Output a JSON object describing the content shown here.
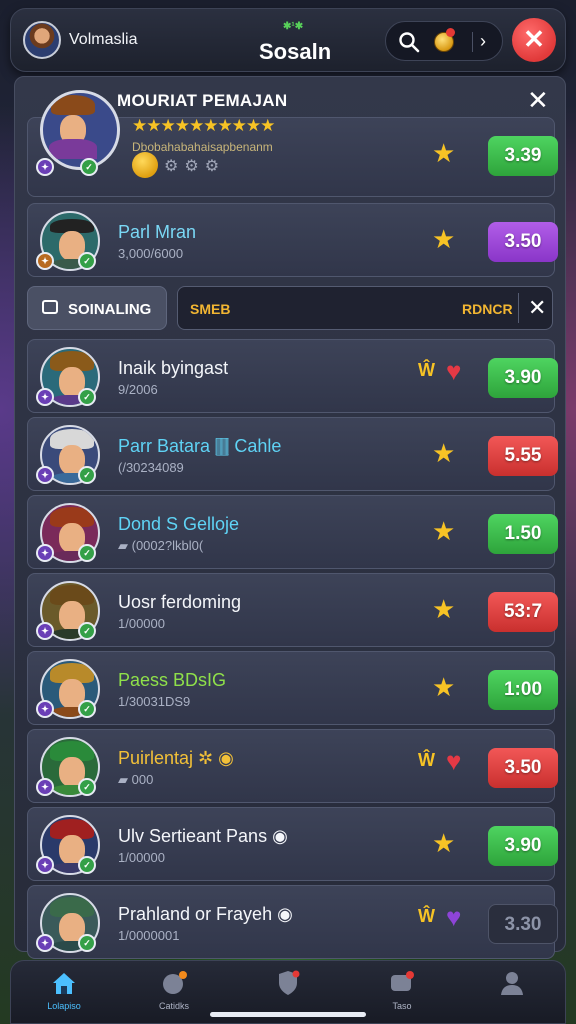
{
  "header": {
    "brand_name": "Volmaslia",
    "title": "Sosaln",
    "title_flair": "✱¹✱"
  },
  "panel": {
    "title": "MOURIAT PEMAJAN",
    "featured": {
      "rating_stars": "★★★★★★★★★★",
      "subtitle": "Dbobahabahaisapbenanm",
      "gears": "⚙⚙⚙",
      "score": "3.39",
      "icon": "star-icon"
    },
    "second": {
      "name": "Parl Mran",
      "sub": "3,000/6000",
      "score": "3.50",
      "icon": "star-icon"
    },
    "filter": {
      "tab_label": "SOINALING",
      "search_left": "SMEB",
      "search_right": "RDNCR"
    },
    "players": [
      {
        "name": "Inaik byingast",
        "sub": "9/2006",
        "icon": "heart-icon",
        "lock": "Ŵ",
        "heart_color": "#e53945",
        "score": "3.90",
        "score_color": "green",
        "name_color": "#f4f6fa"
      },
      {
        "name": "Parr Batara 🀫 Cahle",
        "sub": "(/30234089",
        "icon": "star-icon",
        "score": "5.55",
        "score_color": "red",
        "name_color": "#5fd3f5"
      },
      {
        "name": "Dond S Gelloje",
        "sub": "▰ (0002?lkbl0(",
        "icon": "star-icon",
        "score": "1.50",
        "score_color": "green",
        "name_color": "#5fd3f5"
      },
      {
        "name": "Uosr ferdoming",
        "sub": "1/00000",
        "icon": "star-icon",
        "score": "53:7",
        "score_color": "red",
        "name_color": "#f4f6fa"
      },
      {
        "name": "Paess BDsIG",
        "sub": "1/30031DS9",
        "icon": "star-icon",
        "score": "1:00",
        "score_color": "green",
        "name_color": "#8fe04a"
      },
      {
        "name": "Puirlentaj ✲ ◉",
        "sub": "▰ 000",
        "icon": "heart-icon",
        "lock": "Ŵ",
        "heart_color": "#e53945",
        "score": "3.50",
        "score_color": "red",
        "name_color": "#f2c038"
      },
      {
        "name": "Ulv Sertieant Pans ◉",
        "sub": "1/00000",
        "icon": "star-icon",
        "score": "3.90",
        "score_color": "green",
        "name_color": "#f4f6fa"
      },
      {
        "name": "Prahland or Frayeh ◉",
        "sub": "1/0000001",
        "icon": "heart-icon",
        "lock": "Ŵ",
        "heart_color": "#8e44d8",
        "score": "3.30",
        "score_color": "dark",
        "name_color": "#f4f6fa"
      }
    ]
  },
  "nav": [
    {
      "label": "Lolapiso",
      "icon": "home-icon",
      "active": true
    },
    {
      "label": "Catidks",
      "icon": "ball-icon",
      "active": false
    },
    {
      "label": "",
      "icon": "shield-icon",
      "active": false
    },
    {
      "label": "Taso",
      "icon": "chat-icon",
      "active": false
    },
    {
      "label": "",
      "icon": "profile-icon",
      "active": false
    }
  ],
  "colors": {
    "accent_green": "#3cc14c",
    "accent_red": "#e13a3a",
    "accent_purple": "#9b48d8",
    "star": "#f7c325",
    "nav_active": "#4cc0ff"
  }
}
